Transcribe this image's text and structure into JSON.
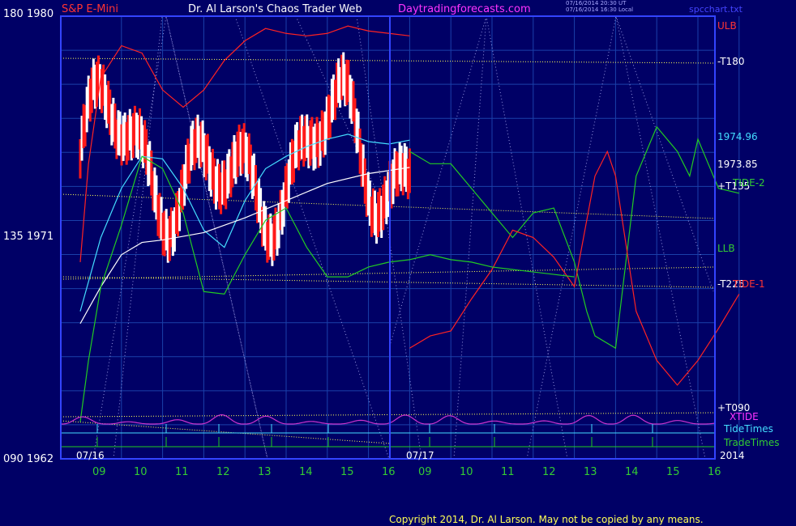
{
  "header": {
    "instrument": "S&P E-Mini",
    "author": "Dr. Al Larson's Chaos Trader Web",
    "site": "Daytradingforecasts.com",
    "stamp1": "07/16/2014 20:30 UT",
    "stamp2": "07/16/2014 16:30 Local",
    "file": "spcchart.txt"
  },
  "footer": {
    "copyright": "Copyright 2014, Dr. Al Larson. May not be copied by any means."
  },
  "colors": {
    "background": "#000066",
    "grid": "#1a40aa",
    "frame": "#3344ff",
    "price_up": "#ffffff",
    "price_down": "#ff1a1a",
    "red": "#ff2222",
    "green": "#22cc22",
    "cyan": "#44ddff",
    "yellow": "#ffff55",
    "magenta": "#cc33cc",
    "white": "#ffffff"
  },
  "chart_data": {
    "type": "line",
    "title": "S&P E-Mini",
    "ylabels": [
      {
        "angle": "180",
        "price": "1980",
        "value": 1980
      },
      {
        "angle": "135",
        "price": "1971",
        "value": 1971
      },
      {
        "angle": "090",
        "price": "1962",
        "value": 1962
      }
    ],
    "ylim": [
      1962,
      1980
    ],
    "date_labels": [
      "07/16",
      "07/17"
    ],
    "year_label": "2014",
    "hours": [
      "09",
      "10",
      "11",
      "12",
      "13",
      "14",
      "15",
      "16",
      "09",
      "10",
      "11",
      "12",
      "13",
      "14",
      "15",
      "16"
    ],
    "right_labels": [
      {
        "text": "ULB",
        "color": "red",
        "value": 1979.5
      },
      {
        "text": "-T180",
        "color": "white",
        "value": 1978
      },
      {
        "text": "1974.96",
        "color": "cyan",
        "value": 1974.96
      },
      {
        "text": "1973.85",
        "color": "white",
        "value": 1973.85
      },
      {
        "text": "+T135",
        "color": "white",
        "value": 1972.8
      },
      {
        "text": "TIDE-2",
        "color": "green",
        "value": 1972.85
      },
      {
        "text": "LLB",
        "color": "green",
        "value": 1970.2
      },
      {
        "text": "-T225",
        "color": "white",
        "value": 1968.8
      },
      {
        "text": "TIDE-1",
        "color": "red",
        "value": 1968.75
      },
      {
        "text": "+T090",
        "color": "white",
        "value": 1963.7
      },
      {
        "text": "XTIDE",
        "color": "magenta",
        "value": 1963.3
      },
      {
        "text": "TideTimes",
        "color": "cyan",
        "value": 1962.7
      },
      {
        "text": "TradeTimes",
        "color": "green",
        "value": 1962.15
      }
    ],
    "series": [
      {
        "name": "ULB",
        "color": "red",
        "x": [
          0,
          0.2,
          0.5,
          1,
          1.5,
          2,
          2.5,
          3,
          3.5,
          4,
          4.5,
          5,
          5.5,
          6,
          6.5,
          7,
          7.5,
          8
        ],
        "y": [
          1970,
          1974,
          1977.5,
          1978.8,
          1978.5,
          1977,
          1976.3,
          1977,
          1978.2,
          1979,
          1979.5,
          1979.3,
          1979.2,
          1979.3,
          1979.6,
          1979.4,
          1979.3,
          1979.2
        ]
      },
      {
        "name": "TIDE-2",
        "color": "green",
        "x": [
          8,
          8.5,
          9,
          9.5,
          10,
          10.5,
          11,
          11.5,
          12,
          12.3,
          12.5,
          13,
          13.5,
          14,
          14.5,
          14.8,
          15,
          15.5,
          16
        ],
        "y": [
          1974.5,
          1974,
          1974,
          1973,
          1972,
          1971,
          1972,
          1972.2,
          1970,
          1968,
          1967,
          1966.5,
          1973.5,
          1975.5,
          1974.5,
          1973.5,
          1975,
          1973,
          1972.8
        ]
      },
      {
        "name": "TIDE-1",
        "color": "red",
        "x": [
          8,
          8.5,
          9,
          9.5,
          10,
          10.5,
          11,
          11.5,
          12,
          12.5,
          12.8,
          13,
          13.5,
          14,
          14.5,
          15,
          15.5,
          16
        ],
        "y": [
          1966.5,
          1967,
          1967.2,
          1968.5,
          1969.7,
          1971.3,
          1971,
          1970.2,
          1969,
          1973.5,
          1974.5,
          1973.5,
          1968,
          1966,
          1965,
          1966,
          1967.3,
          1968.7
        ]
      },
      {
        "name": "LLB",
        "color": "green",
        "x": [
          8,
          8.5,
          9,
          9.5,
          10,
          10.5,
          11,
          11.5,
          12
        ],
        "y": [
          1970.1,
          1970.3,
          1970.1,
          1970,
          1969.8,
          1969.7,
          1969.6,
          1969.5,
          1969.4
        ]
      },
      {
        "name": "Avg 1",
        "color": "cyan",
        "x": [
          0,
          0.5,
          1,
          1.5,
          2,
          2.5,
          3,
          3.5,
          4,
          4.5,
          5,
          5.5,
          6,
          6.5,
          7,
          7.5,
          8
        ],
        "y": [
          1968,
          1971,
          1973,
          1974.3,
          1974.2,
          1973,
          1971.3,
          1970.6,
          1972.5,
          1973.8,
          1974.3,
          1974.7,
          1975,
          1975.2,
          1974.9,
          1974.8,
          1974.96
        ]
      },
      {
        "name": "Avg 2",
        "color": "white",
        "x": [
          0,
          0.5,
          1,
          1.5,
          2,
          3,
          4,
          5,
          6,
          7,
          8
        ],
        "y": [
          1967.5,
          1969,
          1970.3,
          1970.8,
          1970.9,
          1971.2,
          1971.8,
          1972.5,
          1973.2,
          1973.6,
          1973.85
        ]
      },
      {
        "name": "Green 2",
        "color": "green",
        "x": [
          0,
          0.2,
          0.5,
          1,
          1.5,
          2,
          2.5,
          3,
          3.5,
          4,
          4.5,
          5,
          5.5,
          6,
          6.5,
          7,
          7.5,
          8
        ],
        "y": [
          1963.5,
          1966,
          1969,
          1971.5,
          1974.3,
          1973.8,
          1972,
          1968.8,
          1968.7,
          1970.3,
          1971.7,
          1972.2,
          1970.6,
          1969.4,
          1969.4,
          1969.8,
          1970,
          1970.1
        ]
      }
    ]
  }
}
